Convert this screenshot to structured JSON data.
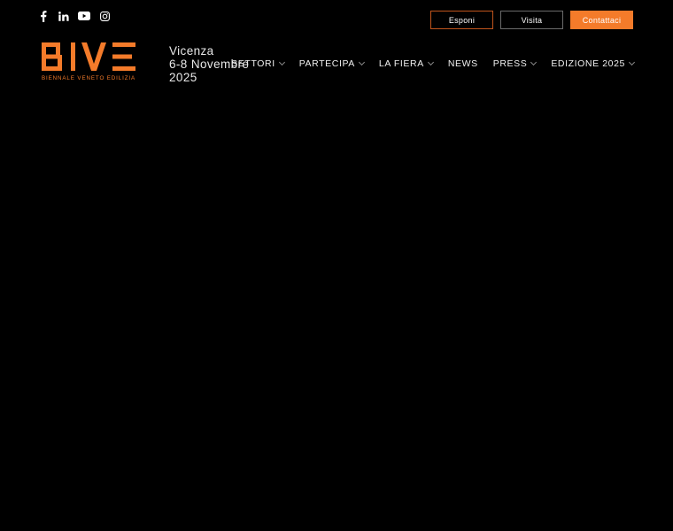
{
  "social": [
    {
      "name": "facebook-icon"
    },
    {
      "name": "linkedin-icon"
    },
    {
      "name": "youtube-icon"
    },
    {
      "name": "instagram-icon"
    }
  ],
  "top_buttons": {
    "esponi": "Esponi",
    "visita": "Visita",
    "contattaci": "Contattaci"
  },
  "logo": {
    "subtitle": "BIENNALE VENETO EDILIZIA"
  },
  "event": {
    "city": "Vicenza",
    "dates": "6-8 Novembre",
    "year": "2025"
  },
  "nav": {
    "items": [
      {
        "label": "SETTORI",
        "has_dropdown": true
      },
      {
        "label": "PARTECIPA",
        "has_dropdown": true
      },
      {
        "label": "LA FIERA",
        "has_dropdown": true
      },
      {
        "label": "NEWS",
        "has_dropdown": false
      },
      {
        "label": "PRESS",
        "has_dropdown": true
      },
      {
        "label": "EDIZIONE 2025",
        "has_dropdown": true
      }
    ]
  },
  "colors": {
    "accent": "#f47b2a",
    "background": "#000000",
    "text": "#ffffff"
  }
}
